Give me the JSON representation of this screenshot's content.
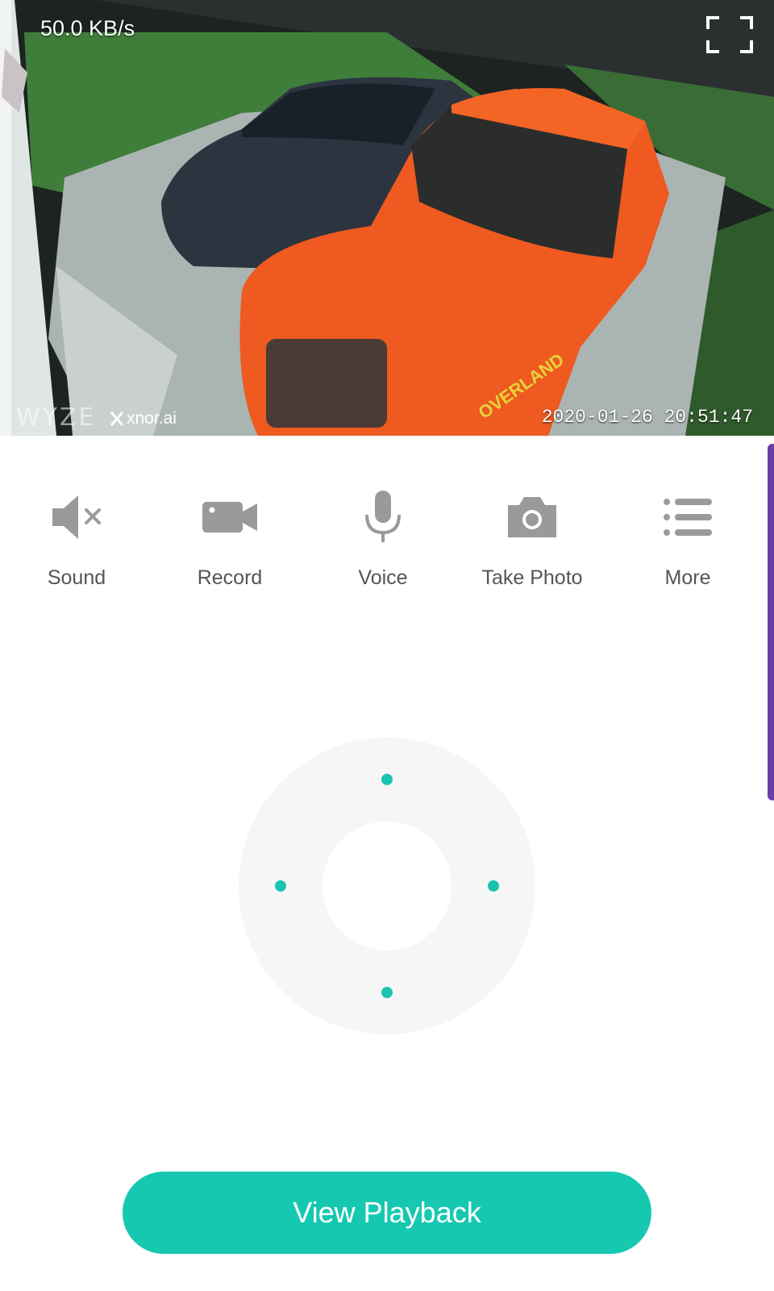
{
  "feed": {
    "bitrate": "50.0 KB/s",
    "timestamp": "2020-01-26  20:51:47",
    "brand_camera": "WYZE",
    "brand_ai": "xnor.ai",
    "vehicle_text": "OVERLAND"
  },
  "actions": [
    {
      "label": "Sound",
      "icon": "speaker-muted-icon"
    },
    {
      "label": "Record",
      "icon": "video-camera-icon"
    },
    {
      "label": "Voice",
      "icon": "microphone-icon"
    },
    {
      "label": "Take Photo",
      "icon": "camera-icon"
    },
    {
      "label": "More",
      "icon": "list-icon"
    }
  ],
  "playback_button": {
    "label": "View Playback"
  },
  "colors": {
    "accent": "#17c8b1",
    "icon_gray": "#9a9a9a",
    "scroll_indicator": "#6b3fa6"
  }
}
